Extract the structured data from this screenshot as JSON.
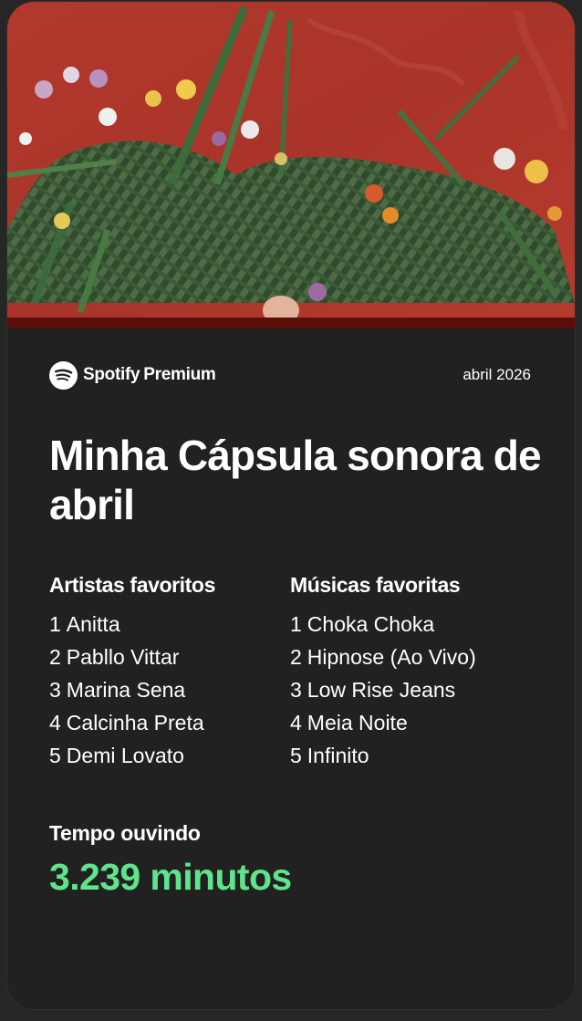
{
  "brand": {
    "name": "Spotify",
    "tier": "Premium",
    "logo_icon": "spotify-logo-icon"
  },
  "date": "abril 2026",
  "title": "Minha Cápsula sonora de abril",
  "artists": {
    "heading": "Artistas favoritos",
    "items": [
      {
        "rank": "1",
        "name": "Anitta"
      },
      {
        "rank": "2",
        "name": "Pabllo Vittar"
      },
      {
        "rank": "3",
        "name": "Marina Sena"
      },
      {
        "rank": "4",
        "name": "Calcinha Preta"
      },
      {
        "rank": "5",
        "name": "Demi Lovato"
      }
    ]
  },
  "songs": {
    "heading": "Músicas favoritas",
    "items": [
      {
        "rank": "1",
        "name": "Choka Choka"
      },
      {
        "rank": "2",
        "name": "Hipnose (Ao Vivo)"
      },
      {
        "rank": "3",
        "name": "Low Rise Jeans"
      },
      {
        "rank": "4",
        "name": "Meia Noite"
      },
      {
        "rank": "5",
        "name": "Infinito"
      }
    ]
  },
  "listening_time": {
    "label": "Tempo ouvindo",
    "value": "3.239 minutos"
  },
  "colors": {
    "accent": "#5ee58c",
    "card_background": "#212121",
    "cover_background": "#b0372c"
  }
}
